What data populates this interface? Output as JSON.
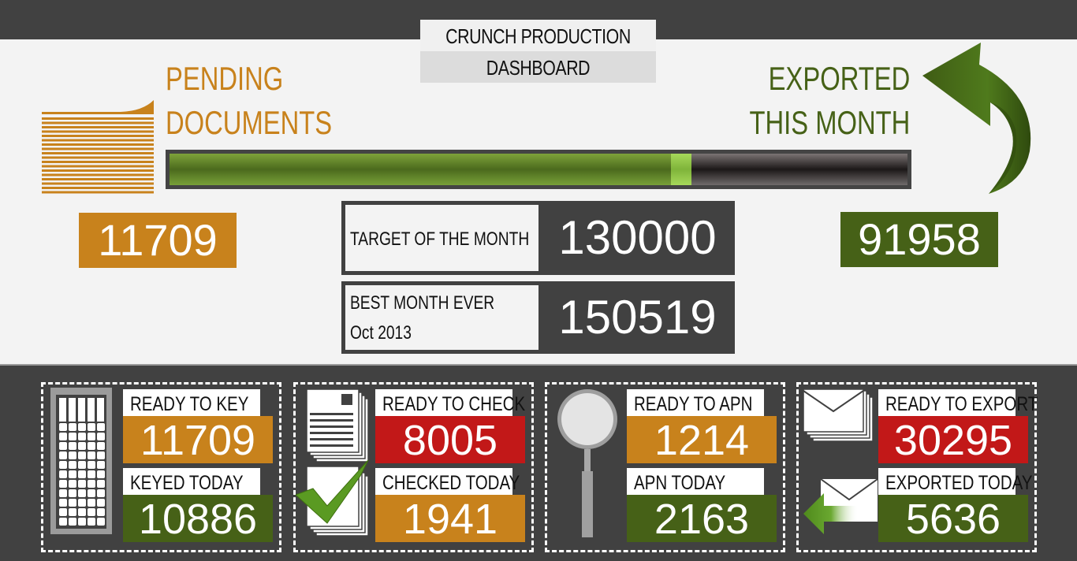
{
  "header": {
    "title_line1": "CRUNCH PRODUCTION",
    "title_line2": "DASHBOARD"
  },
  "pending": {
    "label_line1": "PENDING",
    "label_line2": "DOCUMENTS",
    "value": "11709",
    "icon": "document-stack-icon"
  },
  "exported": {
    "label_line1": "EXPORTED",
    "label_line2": "THIS MONTH",
    "value": "91958",
    "icon": "curved-arrow-icon"
  },
  "progress": {
    "fraction": 0.707,
    "label": "Exported this month vs target"
  },
  "target": {
    "label": "TARGET OF THE MONTH",
    "value": "130000"
  },
  "best_month": {
    "label_line1": "BEST MONTH EVER",
    "label_line2": "Oct 2013",
    "value": "150519"
  },
  "panels": [
    {
      "icon": "keyboard-icon",
      "top_label": "READY TO KEY",
      "top_value": "11709",
      "top_color": "#c8821c",
      "bottom_label": "KEYED TODAY",
      "bottom_value": "10886",
      "bottom_color": "#466117"
    },
    {
      "icon": "checked-documents-icon",
      "top_label": "READY TO CHECK",
      "top_value": "8005",
      "top_color": "#c21818",
      "bottom_label": "CHECKED TODAY",
      "bottom_value": "1941",
      "bottom_color": "#c8821c"
    },
    {
      "icon": "magnifier-icon",
      "top_label": "READY TO APN",
      "top_value": "1214",
      "top_color": "#c8821c",
      "bottom_label": "APN TODAY",
      "bottom_value": "2163",
      "bottom_color": "#466117"
    },
    {
      "icon": "envelope-export-icon",
      "top_label": "READY TO EXPORT",
      "top_value": "30295",
      "top_color": "#c21818",
      "bottom_label": "EXPORTED TODAY",
      "bottom_value": "5636",
      "bottom_color": "#466117"
    }
  ],
  "colors": {
    "orange": "#c8821c",
    "green": "#466117",
    "red": "#c21818",
    "dark": "#414141"
  }
}
